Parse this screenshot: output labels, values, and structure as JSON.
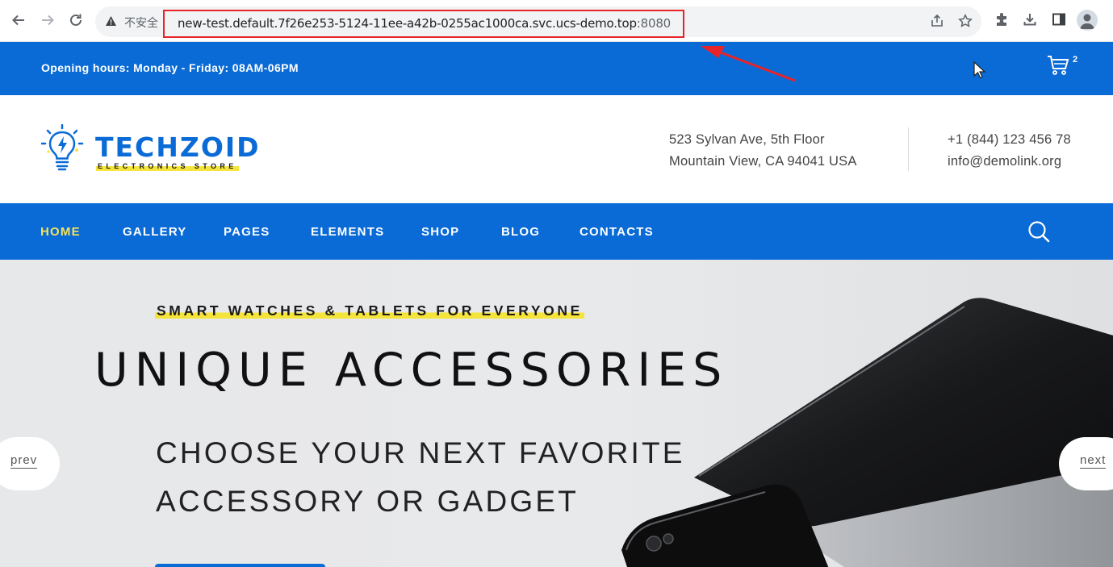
{
  "browser": {
    "insecure_label": "不安全",
    "url": "new-test.default.7f26e253-5124-11ee-a42b-0255ac1000ca.svc.ucs-demo.top",
    "url_port": ":8080"
  },
  "topbar": {
    "hours": "Opening hours: Monday - Friday: 08AM-06PM",
    "cart_count": "2"
  },
  "header": {
    "logo_name": "TECHZOID",
    "logo_tagline": "ELECTRONICS STORE",
    "address_line1": "523 Sylvan Ave, 5th Floor",
    "address_line2": "Mountain View, CA 94041 USA",
    "phone": "+1 (844) 123 456 78",
    "email": "info@demolink.org"
  },
  "nav": {
    "items": [
      {
        "label": "HOME",
        "active": true
      },
      {
        "label": "GALLERY"
      },
      {
        "label": "PAGES"
      },
      {
        "label": "ELEMENTS"
      },
      {
        "label": "SHOP"
      },
      {
        "label": "BLOG"
      },
      {
        "label": "CONTACTS"
      }
    ]
  },
  "hero": {
    "kicker": "SMART WATCHES & TABLETS FOR EVERYONE",
    "headline": "UNIQUE ACCESSORIES",
    "subline1": "CHOOSE YOUR NEXT FAVORITE",
    "subline2": "ACCESSORY OR GADGET",
    "prev_label": "prev",
    "next_label": "next"
  },
  "colors": {
    "brand_blue": "#0a6bd6",
    "accent_yellow": "#f5e43a",
    "annotation_red": "#e8242a"
  }
}
